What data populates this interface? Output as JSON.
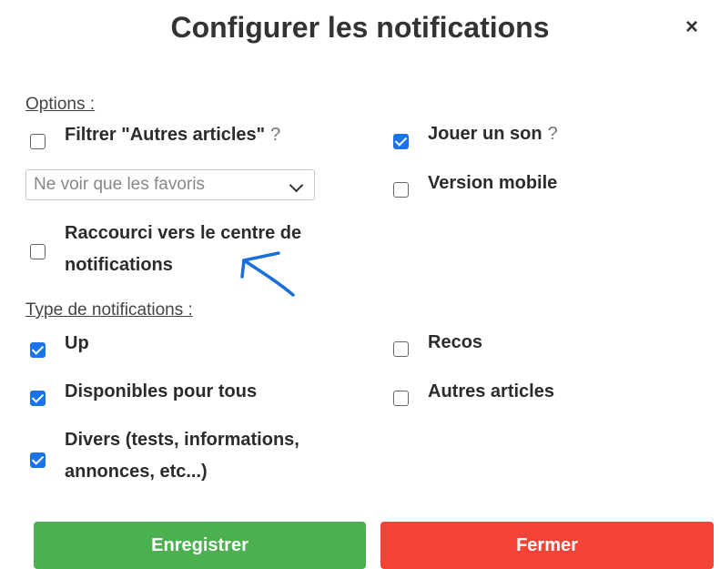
{
  "dialog": {
    "title": "Configurer les notifications",
    "close_glyph": "×"
  },
  "options": {
    "label": "Options :",
    "filtrer": {
      "label": "Filtrer \"Autres articles\"",
      "help": "?",
      "checked": false
    },
    "filter_select": {
      "value": "Ne voir que les favoris"
    },
    "raccourci": {
      "line1": "Raccourci vers le centre de",
      "line2": "notifications",
      "checked": false
    },
    "jouer_son": {
      "label": "Jouer un son",
      "help": "?",
      "checked": true
    },
    "version_mobile": {
      "label": "Version mobile",
      "checked": false
    }
  },
  "types": {
    "label": "Type de notifications :",
    "up": {
      "label": "Up",
      "checked": true
    },
    "disponibles": {
      "label": "Disponibles pour tous",
      "checked": true
    },
    "divers": {
      "line1": "Divers (tests, informations,",
      "line2": "annonces, etc...)",
      "checked": true
    },
    "recos": {
      "label": "Recos",
      "checked": false
    },
    "autres": {
      "label": "Autres articles",
      "checked": false
    }
  },
  "buttons": {
    "save": "Enregistrer",
    "close": "Fermer"
  },
  "colors": {
    "checkbox_checked": "#1a73e8",
    "save_button": "#4caf50",
    "close_button": "#f44336",
    "annotation_arrow": "#1a6fd8"
  },
  "icons": {
    "close": "close-icon",
    "dropdown": "chevron-down-icon",
    "annotation": "hand-drawn-arrow"
  }
}
